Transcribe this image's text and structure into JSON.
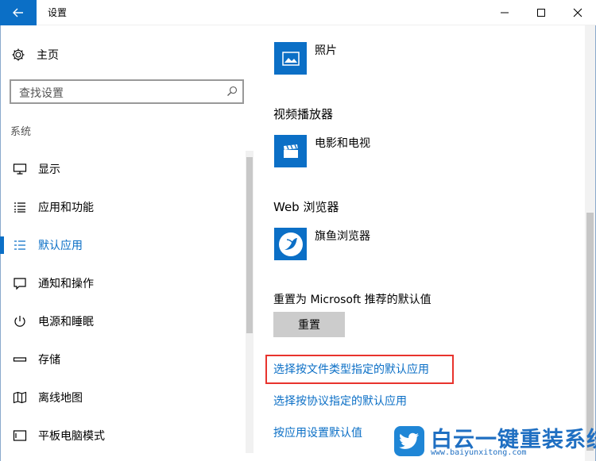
{
  "window": {
    "title": "设置"
  },
  "sidebar": {
    "home_label": "主页",
    "search_placeholder": "查找设置",
    "section_label": "系统",
    "items": [
      {
        "label": "显示",
        "icon": "display-icon"
      },
      {
        "label": "应用和功能",
        "icon": "apps-list-icon"
      },
      {
        "label": "默认应用",
        "icon": "default-apps-icon",
        "active": true
      },
      {
        "label": "通知和操作",
        "icon": "notification-icon"
      },
      {
        "label": "电源和睡眠",
        "icon": "power-icon"
      },
      {
        "label": "存储",
        "icon": "storage-icon"
      },
      {
        "label": "离线地图",
        "icon": "map-icon"
      },
      {
        "label": "平板电脑模式",
        "icon": "tablet-icon"
      }
    ]
  },
  "main": {
    "photo_app": "照片",
    "video_heading": "视频播放器",
    "video_app": "电影和电视",
    "browser_heading": "Web 浏览器",
    "browser_app": "旗鱼浏览器",
    "reset_heading": "重置为 Microsoft 推荐的默认值",
    "reset_button": "重置",
    "links": [
      "选择按文件类型指定的默认应用",
      "选择按协议指定的默认应用",
      "按应用设置默认值"
    ]
  },
  "watermark": {
    "brand": "白云一键重装系统",
    "url": "www.baiyunxitong.com"
  },
  "colors": {
    "accent": "#0b6fc6",
    "highlight_border": "#e8332d",
    "reset_button_bg": "#cccccc"
  }
}
